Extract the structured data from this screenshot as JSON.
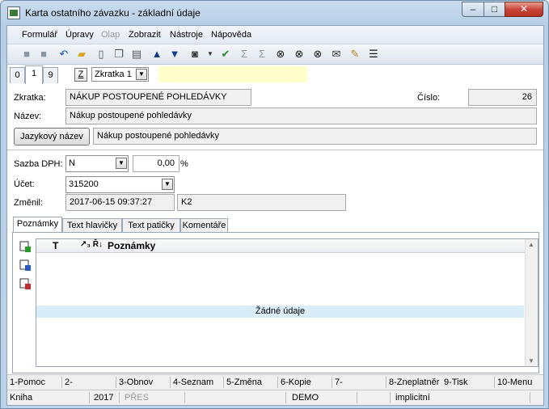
{
  "window": {
    "title": "Karta ostatního závazku - základní údaje",
    "min": "–",
    "max": "□",
    "close": "✕"
  },
  "menu": [
    "Formulář",
    "Úpravy",
    "Olap",
    "Zobrazit",
    "Nástroje",
    "Nápověda"
  ],
  "num_tabs": [
    "0",
    "1",
    "9"
  ],
  "z_button": "Z",
  "sort_combo": {
    "value": "Zkratka 1"
  },
  "form": {
    "zkratka_label": "Zkratka:",
    "zkratka_value": "NÁKUP POSTOUPENÉ POHLEDÁVKY",
    "cislo_label": "Číslo:",
    "cislo_value": "26",
    "nazev_label": "Název:",
    "nazev_value": "Nákup postoupené pohledávky",
    "jazykovy_button": "Jazykový název",
    "jazykovy_value": "Nákup postoupené pohledávky",
    "sazba_label": "Sazba DPH:",
    "sazba_value": "N",
    "sazba_percent": "0,00",
    "percent_sign": "%",
    "ucet_label": "Účet:",
    "ucet_value": "315200",
    "zmenil_label": "Změnil:",
    "zmenil_date": "2017-06-15 09:37:27",
    "zmenil_user": "K2"
  },
  "subtabs": [
    "Poznámky",
    "Text hlavičky",
    "Text patičky",
    "Komentáře"
  ],
  "grid": {
    "col_t": "T",
    "col_sort": "↗₃ Ř↓",
    "col_poznamky": "Poznámky",
    "empty": "Žádné údaje"
  },
  "fkeys": [
    "1-Pomoc",
    "2-",
    "3-Obnov",
    "4-Seznam",
    "5-Změna",
    "6-Kopie",
    "7-",
    "8-Zneplatněr",
    "9-Tisk",
    "10-Menu"
  ],
  "status": {
    "kniha": "Kniha",
    "year": "2017",
    "pres": "PŘES",
    "db": "DEMO",
    "mode": "implicitní"
  },
  "colors": {
    "accent_yellow": "#ffffcc",
    "nodata_bg": "#d9edf8",
    "close_red": "#c8463a"
  }
}
